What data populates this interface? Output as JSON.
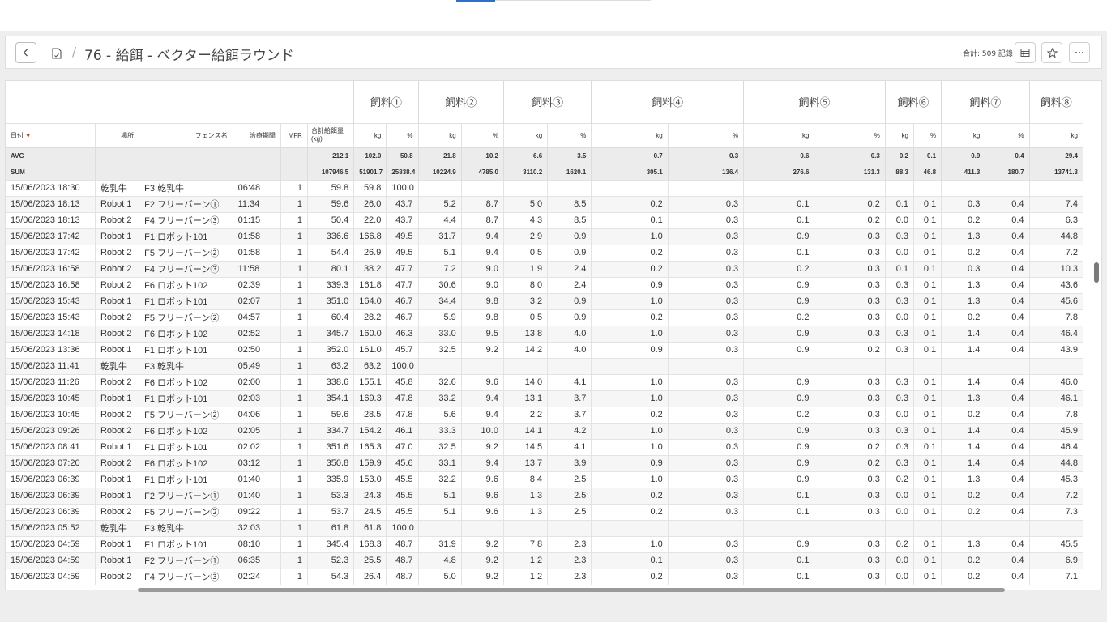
{
  "header": {
    "title": "76 - 給餌 - ベクター給餌ラウンド",
    "breadcrumb_separator": "/",
    "total": "合計: 509 記錄"
  },
  "table": {
    "feed_groups": [
      "飼料①",
      "飼料②",
      "飼料③",
      "飼料④",
      "飼料⑤",
      "飼料⑥",
      "飼料⑦",
      "飼料⑧"
    ],
    "columns": {
      "date": "日付",
      "place": "場所",
      "fence": "フェンス名",
      "period": "治療期間",
      "mfr": "MFR",
      "total": "合計給餌量 (kg)",
      "kg": "kg",
      "pct": "%"
    },
    "avg": {
      "label": "AVG",
      "values": [
        "212.1",
        "102.0",
        "50.8",
        "21.8",
        "10.2",
        "6.6",
        "3.5",
        "0.7",
        "0.3",
        "0.6",
        "0.3",
        "0.2",
        "0.1",
        "0.9",
        "0.4",
        "29.4"
      ]
    },
    "sum": {
      "label": "SUM",
      "values": [
        "107946.5",
        "51901.7",
        "25838.4",
        "10224.9",
        "4785.0",
        "3110.2",
        "1620.1",
        "305.1",
        "136.4",
        "276.6",
        "131.3",
        "88.3",
        "46.8",
        "411.3",
        "180.7",
        "13741.3"
      ]
    },
    "rows": [
      [
        "15/06/2023 18:30",
        "乾乳牛",
        "F3 乾乳牛",
        "06:48",
        "1",
        "59.8",
        "59.8",
        "100.0",
        "",
        "",
        "",
        "",
        "",
        "",
        "",
        "",
        "",
        "",
        "",
        "",
        ""
      ],
      [
        "15/06/2023 18:13",
        "Robot 1",
        "F2 フリーバーン①",
        "11:34",
        "1",
        "59.6",
        "26.0",
        "43.7",
        "5.2",
        "8.7",
        "5.0",
        "8.5",
        "0.2",
        "0.3",
        "0.1",
        "0.2",
        "0.1",
        "0.1",
        "0.3",
        "0.4",
        "7.4"
      ],
      [
        "15/06/2023 18:13",
        "Robot 2",
        "F4 フリーバーン③",
        "01:15",
        "1",
        "50.4",
        "22.0",
        "43.7",
        "4.4",
        "8.7",
        "4.3",
        "8.5",
        "0.1",
        "0.3",
        "0.1",
        "0.2",
        "0.0",
        "0.1",
        "0.2",
        "0.4",
        "6.3"
      ],
      [
        "15/06/2023 17:42",
        "Robot 1",
        "F1 ロボット101",
        "01:58",
        "1",
        "336.6",
        "166.8",
        "49.5",
        "31.7",
        "9.4",
        "2.9",
        "0.9",
        "1.0",
        "0.3",
        "0.9",
        "0.3",
        "0.3",
        "0.1",
        "1.3",
        "0.4",
        "44.8"
      ],
      [
        "15/06/2023 17:42",
        "Robot 2",
        "F5 フリーバーン②",
        "01:58",
        "1",
        "54.4",
        "26.9",
        "49.5",
        "5.1",
        "9.4",
        "0.5",
        "0.9",
        "0.2",
        "0.3",
        "0.1",
        "0.3",
        "0.0",
        "0.1",
        "0.2",
        "0.4",
        "7.2"
      ],
      [
        "15/06/2023 16:58",
        "Robot 2",
        "F4 フリーバーン③",
        "11:58",
        "1",
        "80.1",
        "38.2",
        "47.7",
        "7.2",
        "9.0",
        "1.9",
        "2.4",
        "0.2",
        "0.3",
        "0.2",
        "0.3",
        "0.1",
        "0.1",
        "0.3",
        "0.4",
        "10.3"
      ],
      [
        "15/06/2023 16:58",
        "Robot 2",
        "F6 ロボット102",
        "02:39",
        "1",
        "339.3",
        "161.8",
        "47.7",
        "30.6",
        "9.0",
        "8.0",
        "2.4",
        "0.9",
        "0.3",
        "0.9",
        "0.3",
        "0.3",
        "0.1",
        "1.3",
        "0.4",
        "43.6"
      ],
      [
        "15/06/2023 15:43",
        "Robot 1",
        "F1 ロボット101",
        "02:07",
        "1",
        "351.0",
        "164.0",
        "46.7",
        "34.4",
        "9.8",
        "3.2",
        "0.9",
        "1.0",
        "0.3",
        "0.9",
        "0.3",
        "0.3",
        "0.1",
        "1.3",
        "0.4",
        "45.6"
      ],
      [
        "15/06/2023 15:43",
        "Robot 2",
        "F5 フリーバーン②",
        "04:57",
        "1",
        "60.4",
        "28.2",
        "46.7",
        "5.9",
        "9.8",
        "0.5",
        "0.9",
        "0.2",
        "0.3",
        "0.2",
        "0.3",
        "0.0",
        "0.1",
        "0.2",
        "0.4",
        "7.8"
      ],
      [
        "15/06/2023 14:18",
        "Robot 2",
        "F6 ロボット102",
        "02:52",
        "1",
        "345.7",
        "160.0",
        "46.3",
        "33.0",
        "9.5",
        "13.8",
        "4.0",
        "1.0",
        "0.3",
        "0.9",
        "0.3",
        "0.3",
        "0.1",
        "1.4",
        "0.4",
        "46.4"
      ],
      [
        "15/06/2023 13:36",
        "Robot 1",
        "F1 ロボット101",
        "02:50",
        "1",
        "352.0",
        "161.0",
        "45.7",
        "32.5",
        "9.2",
        "14.2",
        "4.0",
        "0.9",
        "0.3",
        "0.9",
        "0.2",
        "0.3",
        "0.1",
        "1.4",
        "0.4",
        "43.9"
      ],
      [
        "15/06/2023 11:41",
        "乾乳牛",
        "F3 乾乳牛",
        "05:49",
        "1",
        "63.2",
        "63.2",
        "100.0",
        "",
        "",
        "",
        "",
        "",
        "",
        "",
        "",
        "",
        "",
        "",
        "",
        ""
      ],
      [
        "15/06/2023 11:26",
        "Robot 2",
        "F6 ロボット102",
        "02:00",
        "1",
        "338.6",
        "155.1",
        "45.8",
        "32.6",
        "9.6",
        "14.0",
        "4.1",
        "1.0",
        "0.3",
        "0.9",
        "0.3",
        "0.3",
        "0.1",
        "1.4",
        "0.4",
        "46.0"
      ],
      [
        "15/06/2023 10:45",
        "Robot 1",
        "F1 ロボット101",
        "02:03",
        "1",
        "354.1",
        "169.3",
        "47.8",
        "33.2",
        "9.4",
        "13.1",
        "3.7",
        "1.0",
        "0.3",
        "0.9",
        "0.3",
        "0.3",
        "0.1",
        "1.3",
        "0.4",
        "46.1"
      ],
      [
        "15/06/2023 10:45",
        "Robot 2",
        "F5 フリーバーン②",
        "04:06",
        "1",
        "59.6",
        "28.5",
        "47.8",
        "5.6",
        "9.4",
        "2.2",
        "3.7",
        "0.2",
        "0.3",
        "0.2",
        "0.3",
        "0.0",
        "0.1",
        "0.2",
        "0.4",
        "7.8"
      ],
      [
        "15/06/2023 09:26",
        "Robot 2",
        "F6 ロボット102",
        "02:05",
        "1",
        "334.7",
        "154.2",
        "46.1",
        "33.3",
        "10.0",
        "14.1",
        "4.2",
        "1.0",
        "0.3",
        "0.9",
        "0.3",
        "0.3",
        "0.1",
        "1.4",
        "0.4",
        "45.9"
      ],
      [
        "15/06/2023 08:41",
        "Robot 1",
        "F1 ロボット101",
        "02:02",
        "1",
        "351.6",
        "165.3",
        "47.0",
        "32.5",
        "9.2",
        "14.5",
        "4.1",
        "1.0",
        "0.3",
        "0.9",
        "0.2",
        "0.3",
        "0.1",
        "1.4",
        "0.4",
        "46.4"
      ],
      [
        "15/06/2023 07:20",
        "Robot 2",
        "F6 ロボット102",
        "03:12",
        "1",
        "350.8",
        "159.9",
        "45.6",
        "33.1",
        "9.4",
        "13.7",
        "3.9",
        "0.9",
        "0.3",
        "0.9",
        "0.2",
        "0.3",
        "0.1",
        "1.4",
        "0.4",
        "44.8"
      ],
      [
        "15/06/2023 06:39",
        "Robot 1",
        "F1 ロボット101",
        "01:40",
        "1",
        "335.9",
        "153.0",
        "45.5",
        "32.2",
        "9.6",
        "8.4",
        "2.5",
        "1.0",
        "0.3",
        "0.9",
        "0.3",
        "0.2",
        "0.1",
        "1.3",
        "0.4",
        "45.3"
      ],
      [
        "15/06/2023 06:39",
        "Robot 1",
        "F2 フリーバーン①",
        "01:40",
        "1",
        "53.3",
        "24.3",
        "45.5",
        "5.1",
        "9.6",
        "1.3",
        "2.5",
        "0.2",
        "0.3",
        "0.1",
        "0.3",
        "0.0",
        "0.1",
        "0.2",
        "0.4",
        "7.2"
      ],
      [
        "15/06/2023 06:39",
        "Robot 2",
        "F5 フリーバーン②",
        "09:22",
        "1",
        "53.7",
        "24.5",
        "45.5",
        "5.1",
        "9.6",
        "1.3",
        "2.5",
        "0.2",
        "0.3",
        "0.1",
        "0.3",
        "0.0",
        "0.1",
        "0.2",
        "0.4",
        "7.3"
      ],
      [
        "15/06/2023 05:52",
        "乾乳牛",
        "F3 乾乳牛",
        "32:03",
        "1",
        "61.8",
        "61.8",
        "100.0",
        "",
        "",
        "",
        "",
        "",
        "",
        "",
        "",
        "",
        "",
        "",
        "",
        ""
      ],
      [
        "15/06/2023 04:59",
        "Robot 1",
        "F1 ロボット101",
        "08:10",
        "1",
        "345.4",
        "168.3",
        "48.7",
        "31.9",
        "9.2",
        "7.8",
        "2.3",
        "1.0",
        "0.3",
        "0.9",
        "0.3",
        "0.2",
        "0.1",
        "1.3",
        "0.4",
        "45.5"
      ],
      [
        "15/06/2023 04:59",
        "Robot 1",
        "F2 フリーバーン①",
        "06:35",
        "1",
        "52.3",
        "25.5",
        "48.7",
        "4.8",
        "9.2",
        "1.2",
        "2.3",
        "0.1",
        "0.3",
        "0.1",
        "0.3",
        "0.0",
        "0.1",
        "0.2",
        "0.4",
        "6.9"
      ],
      [
        "15/06/2023 04:59",
        "Robot 2",
        "F4 フリーバーン③",
        "02:24",
        "1",
        "54.3",
        "26.4",
        "48.7",
        "5.0",
        "9.2",
        "1.2",
        "2.3",
        "0.2",
        "0.3",
        "0.1",
        "0.3",
        "0.0",
        "0.1",
        "0.2",
        "0.4",
        "7.1"
      ]
    ]
  }
}
